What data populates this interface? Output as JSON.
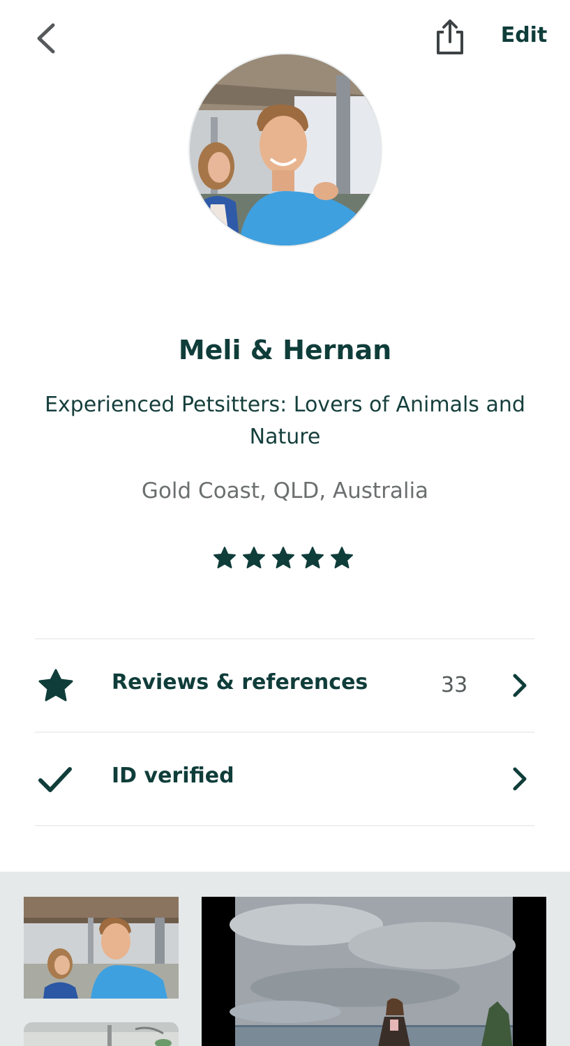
{
  "header": {
    "edit_label": "Edit"
  },
  "profile": {
    "name": "Meli & Hernan",
    "tagline": "Experienced Petsitters: Lovers of Animals and Nature",
    "location": "Gold Coast, QLD, Australia",
    "rating_stars": 5
  },
  "rows": [
    {
      "label": "Reviews & references",
      "count": "33",
      "icon": "star-icon"
    },
    {
      "label": "ID verified",
      "count": "",
      "icon": "checkmark-icon"
    }
  ],
  "colors": {
    "primary": "#0f3d3a",
    "muted": "#6c6f70",
    "gallery_bg": "#e5e9e9"
  }
}
